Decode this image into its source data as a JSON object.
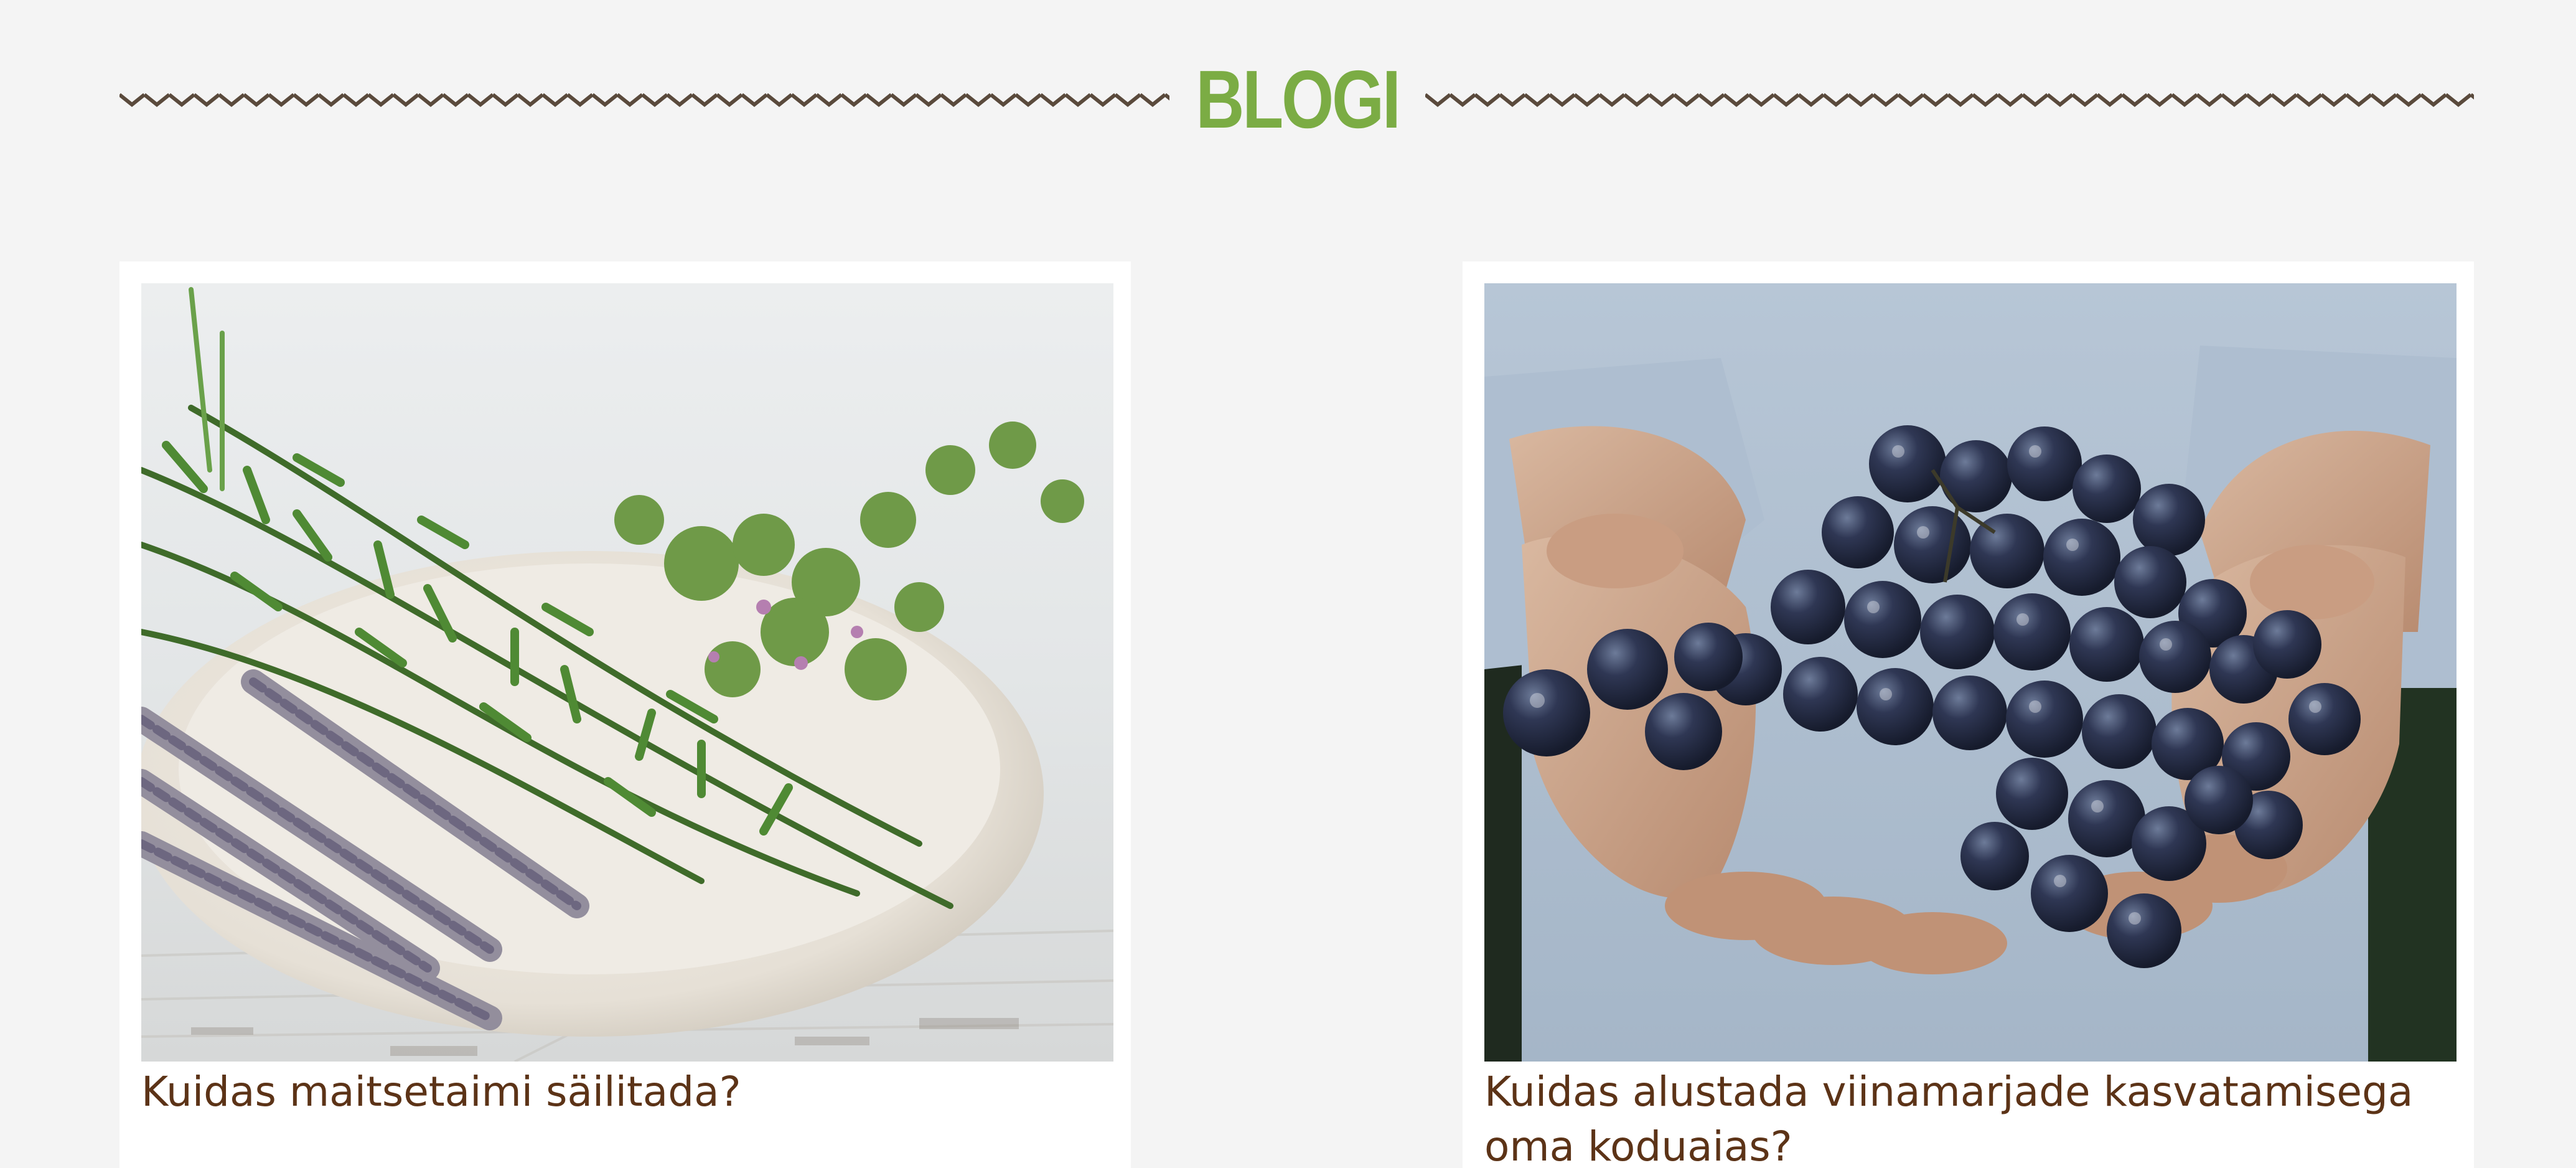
{
  "section": {
    "title": "BLOGI"
  },
  "posts": [
    {
      "title": "Kuidas maitsetaimi säilitada?",
      "image": "herbs-photo"
    },
    {
      "title": "Kuidas alustada viinamarjade kasvatamisega oma koduaias?",
      "image": "grapes-photo"
    }
  ],
  "colors": {
    "background": "#f4f4f4",
    "accent_green": "#7bac44",
    "title_brown": "#5c3317",
    "zigzag": "#5a4a3c",
    "card": "#ffffff"
  }
}
